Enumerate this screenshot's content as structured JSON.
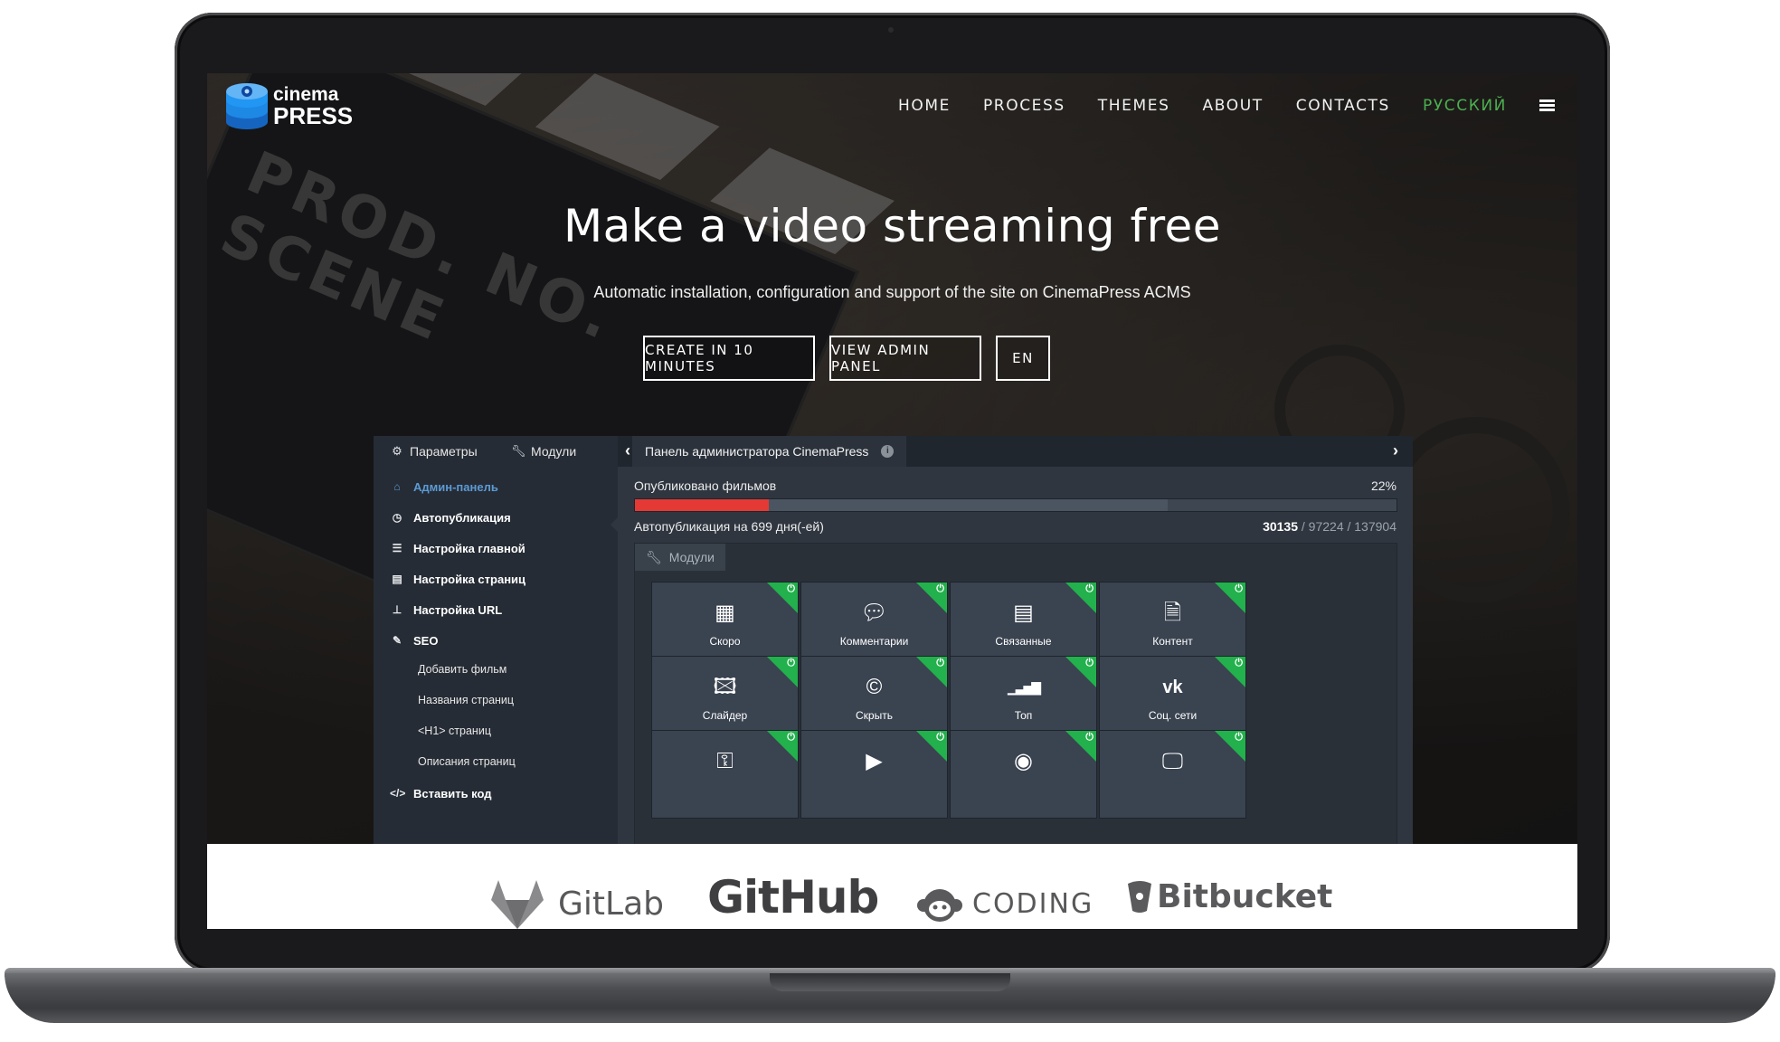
{
  "nav": {
    "logo_top": "cinema",
    "logo_bottom": "PRESS",
    "links": [
      "HOME",
      "PROCESS",
      "THEMES",
      "ABOUT",
      "CONTACTS"
    ],
    "language": "РУССКИЙ",
    "language_color": "#4caf50"
  },
  "hero": {
    "title": "Make a video streaming free",
    "subtitle": "Automatic installation, configuration and support of the site on CinemaPress ACMS",
    "buttons": [
      "CREATE IN 10 MINUTES",
      "VIEW ADMIN PANEL",
      "EN"
    ],
    "background_text": "PROD. NO. SCENE"
  },
  "admin": {
    "tabs": [
      "Параметры",
      "Модули"
    ],
    "panel_title": "Панель администратора CinemaPress",
    "sidebar": [
      {
        "label": "Админ-панель",
        "icon": "home-icon",
        "active": true
      },
      {
        "label": "Автопубликация",
        "icon": "clock-icon"
      },
      {
        "label": "Настройка главной",
        "icon": "bars-icon"
      },
      {
        "label": "Настройка страниц",
        "icon": "list-icon"
      },
      {
        "label": "Настройка URL",
        "icon": "sitemap-icon"
      },
      {
        "label": "SEO",
        "icon": "pencil-icon"
      }
    ],
    "seo_sub": [
      "Добавить фильм",
      "Названия страниц",
      "<H1> страниц",
      "Описания страниц"
    ],
    "insert_code": "Вставить код",
    "published_label": "Опубликовано фильмов",
    "published_percent": "22%",
    "progress": {
      "published_fraction": 0.22,
      "secondary_fraction": 0.7
    },
    "autopub_label": "Автопубликация на 699 дня(-ей)",
    "autopub_count": "30135",
    "autopub_rest": " / 97224 / 137904",
    "modules_tab": "Модули",
    "module_tiles": [
      {
        "label": "Скоро",
        "icon": "calendar-icon"
      },
      {
        "label": "Комментарии",
        "icon": "comments-icon"
      },
      {
        "label": "Связанные",
        "icon": "list-alt-icon"
      },
      {
        "label": "Контент",
        "icon": "file-icon"
      },
      {
        "label": "Слайдер",
        "icon": "image-icon"
      },
      {
        "label": "Скрыть",
        "icon": "copyright-icon"
      },
      {
        "label": "Топ",
        "icon": "signal-icon"
      },
      {
        "label": "Соц. сети",
        "icon": "vk-icon"
      },
      {
        "label": "",
        "icon": "key-icon"
      },
      {
        "label": "",
        "icon": "play-icon"
      },
      {
        "label": "",
        "icon": "eye-icon"
      },
      {
        "label": "",
        "icon": "desktop-icon"
      }
    ],
    "accent_color": "#22b14c",
    "progress_color": "#e53935"
  },
  "logos": [
    "GitLab",
    "GitHub",
    "CODING",
    "Bitbucket"
  ]
}
